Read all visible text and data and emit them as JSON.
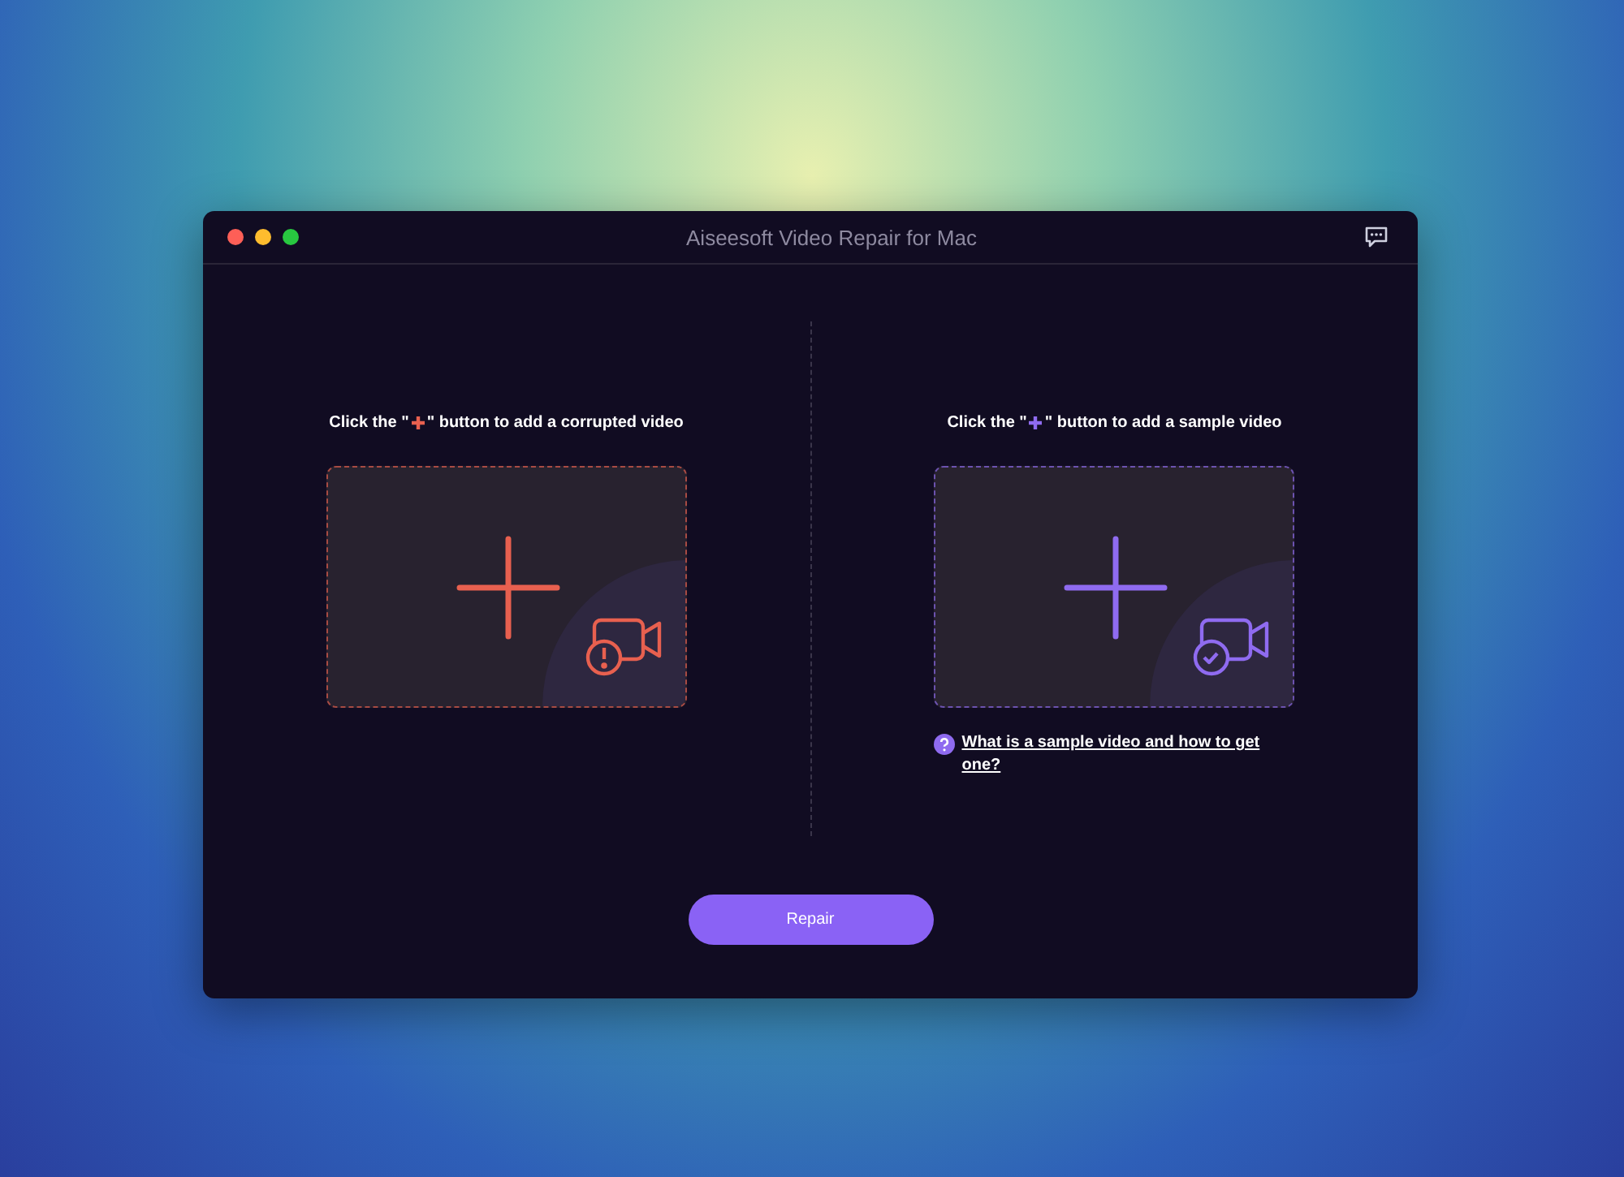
{
  "window": {
    "title": "Aiseesoft Video Repair for Mac"
  },
  "panels": [
    {
      "kind": "corrupted",
      "color": "#e8604f",
      "instruction_before": "Click the \"",
      "instruction_after": "\" button to add a corrupted video"
    },
    {
      "kind": "sample",
      "color": "#8f6bf0",
      "instruction_before": "Click the \"",
      "instruction_after": "\" button to add a sample video",
      "help_link": "What is a sample video and how to get one?"
    }
  ],
  "repair_button": "Repair"
}
